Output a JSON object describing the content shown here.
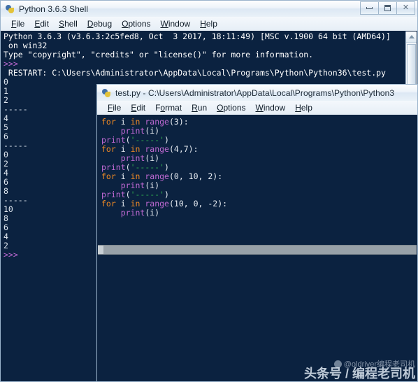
{
  "shell": {
    "title": "Python 3.6.3 Shell",
    "icon": "python-icon",
    "window_buttons": {
      "minimize": "minimize-button",
      "maximize": "maximize-button",
      "close": "close-button"
    },
    "menu": [
      {
        "label": "File",
        "accel": "F"
      },
      {
        "label": "Edit",
        "accel": "E"
      },
      {
        "label": "Shell",
        "accel": "S"
      },
      {
        "label": "Debug",
        "accel": "D"
      },
      {
        "label": "Options",
        "accel": "O"
      },
      {
        "label": "Window",
        "accel": "W"
      },
      {
        "label": "Help",
        "accel": "H"
      }
    ],
    "banner_line1": "Python 3.6.3 (v3.6.3:2c5fed8, Oct  3 2017, 18:11:49) [MSC v.1900 64 bit (AMD64)]",
    "banner_line2": " on win32",
    "banner_line3": "Type \"copyright\", \"credits\" or \"license()\" for more information.",
    "prompt": ">>>",
    "restart_line": " RESTART: C:\\Users\\Administrator\\AppData\\Local\\Programs\\Python\\Python36\\test.py",
    "output": [
      "0",
      "1",
      "2",
      "-----",
      "4",
      "5",
      "6",
      "-----",
      "0",
      "2",
      "4",
      "6",
      "8",
      "-----",
      "10",
      "8",
      "6",
      "4",
      "2"
    ],
    "final_prompt": ">>>"
  },
  "editor": {
    "title": "test.py - C:\\Users\\Administrator\\AppData\\Local\\Programs\\Python\\Python3",
    "icon": "python-icon",
    "menu": [
      {
        "label": "File",
        "accel": "F"
      },
      {
        "label": "Edit",
        "accel": "E"
      },
      {
        "label": "Format",
        "accel": "o"
      },
      {
        "label": "Run",
        "accel": "R"
      },
      {
        "label": "Options",
        "accel": "O"
      },
      {
        "label": "Window",
        "accel": "W"
      },
      {
        "label": "Help",
        "accel": "H"
      }
    ],
    "code_lines": [
      [
        {
          "t": "for",
          "c": "kw"
        },
        {
          "t": " i ",
          "c": "pln"
        },
        {
          "t": "in",
          "c": "kw"
        },
        {
          "t": " ",
          "c": "pln"
        },
        {
          "t": "range",
          "c": "fn"
        },
        {
          "t": "(3):",
          "c": "pln"
        }
      ],
      [
        {
          "t": "    ",
          "c": "pln"
        },
        {
          "t": "print",
          "c": "fn"
        },
        {
          "t": "(i)",
          "c": "pln"
        }
      ],
      [
        {
          "t": "print",
          "c": "fn"
        },
        {
          "t": "(",
          "c": "pln"
        },
        {
          "t": "'-----'",
          "c": "str"
        },
        {
          "t": ")",
          "c": "pln"
        }
      ],
      [
        {
          "t": "for",
          "c": "kw"
        },
        {
          "t": " i ",
          "c": "pln"
        },
        {
          "t": "in",
          "c": "kw"
        },
        {
          "t": " ",
          "c": "pln"
        },
        {
          "t": "range",
          "c": "fn"
        },
        {
          "t": "(4,7):",
          "c": "pln"
        }
      ],
      [
        {
          "t": "    ",
          "c": "pln"
        },
        {
          "t": "print",
          "c": "fn"
        },
        {
          "t": "(i)",
          "c": "pln"
        }
      ],
      [
        {
          "t": "print",
          "c": "fn"
        },
        {
          "t": "(",
          "c": "pln"
        },
        {
          "t": "'-----'",
          "c": "str"
        },
        {
          "t": ")",
          "c": "pln"
        }
      ],
      [
        {
          "t": "for",
          "c": "kw"
        },
        {
          "t": " i ",
          "c": "pln"
        },
        {
          "t": "in",
          "c": "kw"
        },
        {
          "t": " ",
          "c": "pln"
        },
        {
          "t": "range",
          "c": "fn"
        },
        {
          "t": "(0, 10, 2):",
          "c": "pln"
        }
      ],
      [
        {
          "t": "    ",
          "c": "pln"
        },
        {
          "t": "print",
          "c": "fn"
        },
        {
          "t": "(i)",
          "c": "pln"
        }
      ],
      [
        {
          "t": "print",
          "c": "fn"
        },
        {
          "t": "(",
          "c": "pln"
        },
        {
          "t": "'-----'",
          "c": "str"
        },
        {
          "t": ")",
          "c": "pln"
        }
      ],
      [
        {
          "t": "for",
          "c": "kw"
        },
        {
          "t": " i ",
          "c": "pln"
        },
        {
          "t": "in",
          "c": "kw"
        },
        {
          "t": " ",
          "c": "pln"
        },
        {
          "t": "range",
          "c": "fn"
        },
        {
          "t": "(10, 0, -2):",
          "c": "pln"
        }
      ],
      [
        {
          "t": "    ",
          "c": "pln"
        },
        {
          "t": "print",
          "c": "fn"
        },
        {
          "t": "(i)",
          "c": "pln"
        }
      ]
    ]
  },
  "watermark": {
    "handle": "@oldriver编程老司机",
    "main": "头条号 / 编程老司机"
  },
  "colors": {
    "console_bg": "#0b2240",
    "keyword": "#f08a24",
    "function": "#c06ad4",
    "string": "#2fa84f",
    "prompt": "#c06ad4",
    "text": "#ffffff"
  }
}
